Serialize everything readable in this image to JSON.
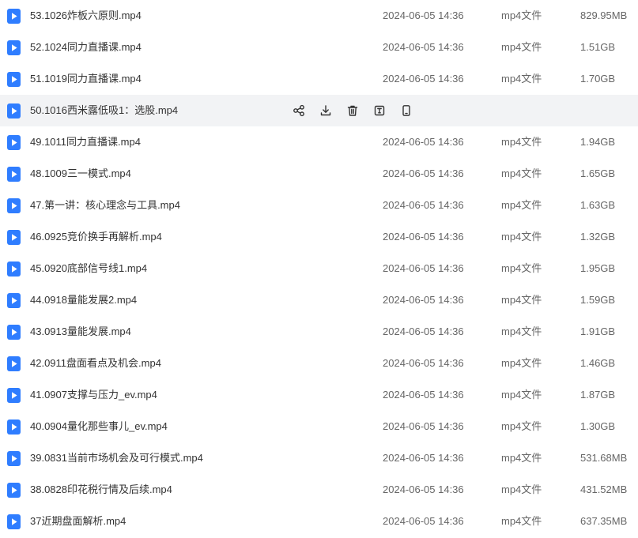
{
  "files": [
    {
      "name": "53.1026炸板六原则.mp4",
      "date": "2024-06-05 14:36",
      "type": "mp4文件",
      "size": "829.95MB"
    },
    {
      "name": "52.1024同力直播课.mp4",
      "date": "2024-06-05 14:36",
      "type": "mp4文件",
      "size": "1.51GB"
    },
    {
      "name": "51.1019同力直播课.mp4",
      "date": "2024-06-05 14:36",
      "type": "mp4文件",
      "size": "1.70GB"
    },
    {
      "name": "50.1016西米露低吸1：选股.mp4",
      "date": "",
      "type": "",
      "size": ""
    },
    {
      "name": "49.1011同力直播课.mp4",
      "date": "2024-06-05 14:36",
      "type": "mp4文件",
      "size": "1.94GB"
    },
    {
      "name": "48.1009三一模式.mp4",
      "date": "2024-06-05 14:36",
      "type": "mp4文件",
      "size": "1.65GB"
    },
    {
      "name": "47.第一讲：核心理念与工具.mp4",
      "date": "2024-06-05 14:36",
      "type": "mp4文件",
      "size": "1.63GB"
    },
    {
      "name": "46.0925竞价换手再解析.mp4",
      "date": "2024-06-05 14:36",
      "type": "mp4文件",
      "size": "1.32GB"
    },
    {
      "name": "45.0920底部信号线1.mp4",
      "date": "2024-06-05 14:36",
      "type": "mp4文件",
      "size": "1.95GB"
    },
    {
      "name": "44.0918量能发展2.mp4",
      "date": "2024-06-05 14:36",
      "type": "mp4文件",
      "size": "1.59GB"
    },
    {
      "name": "43.0913量能发展.mp4",
      "date": "2024-06-05 14:36",
      "type": "mp4文件",
      "size": "1.91GB"
    },
    {
      "name": "42.0911盘面看点及机会.mp4",
      "date": "2024-06-05 14:36",
      "type": "mp4文件",
      "size": "1.46GB"
    },
    {
      "name": "41.0907支撑与压力_ev.mp4",
      "date": "2024-06-05 14:36",
      "type": "mp4文件",
      "size": "1.87GB"
    },
    {
      "name": "40.0904量化那些事儿_ev.mp4",
      "date": "2024-06-05 14:36",
      "type": "mp4文件",
      "size": "1.30GB"
    },
    {
      "name": "39.0831当前市场机会及可行模式.mp4",
      "date": "2024-06-05 14:36",
      "type": "mp4文件",
      "size": "531.68MB"
    },
    {
      "name": "38.0828印花税行情及后续.mp4",
      "date": "2024-06-05 14:36",
      "type": "mp4文件",
      "size": "431.52MB"
    },
    {
      "name": "37近期盘面解析.mp4",
      "date": "2024-06-05 14:36",
      "type": "mp4文件",
      "size": "637.35MB"
    }
  ],
  "hovered_row": 3,
  "row_actions": [
    {
      "name": "share-icon"
    },
    {
      "name": "download-icon"
    },
    {
      "name": "delete-icon"
    },
    {
      "name": "rename-icon"
    },
    {
      "name": "mobile-icon"
    }
  ],
  "colors": {
    "accent": "#2f7dff",
    "hover_background": "#f2f3f5"
  }
}
